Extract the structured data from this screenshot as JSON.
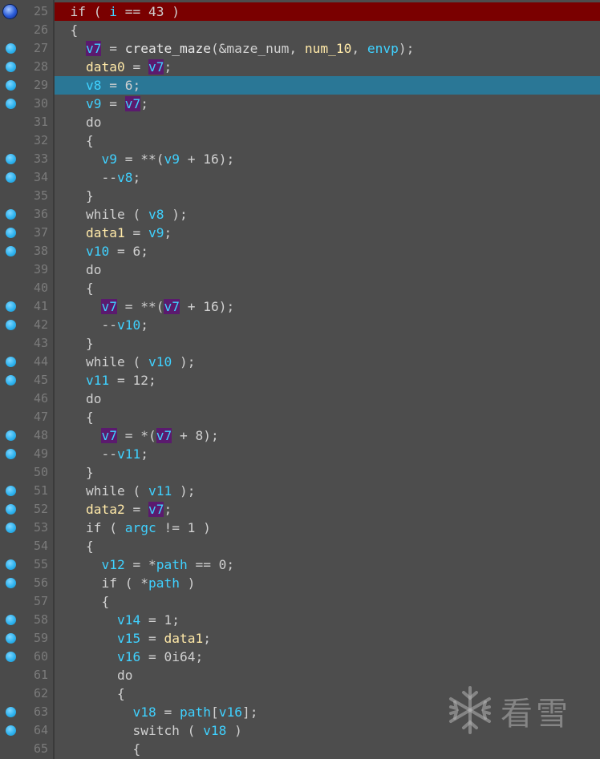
{
  "colors": {
    "background": "#4d4d4d",
    "gutter": "#4a4a4a",
    "current_line_highlight": "#7a0000",
    "selected_line_highlight": "#2a7796",
    "identifier_highlight": "#5b1a6e",
    "local_var": "#3fd1ff",
    "global_var": "#ffe9a8",
    "plain_text": "#d0d0d0",
    "line_number": "#7b7b7b"
  },
  "watermark": {
    "text": "看雪",
    "icon": "snowflake-icon"
  },
  "lines": [
    {
      "num": "25",
      "marker": "breakpoint",
      "highlight": "red",
      "tokens": [
        {
          "t": "  if ( ",
          "c": "kw"
        },
        {
          "t": "i",
          "c": "var"
        },
        {
          "t": " == 43 )",
          "c": "pl"
        }
      ]
    },
    {
      "num": "26",
      "marker": "",
      "highlight": "",
      "tokens": [
        {
          "t": "  {",
          "c": "pl"
        }
      ]
    },
    {
      "num": "27",
      "marker": "dot",
      "highlight": "",
      "tokens": [
        {
          "t": "    ",
          "c": "pl"
        },
        {
          "t": "v7",
          "c": "sel"
        },
        {
          "t": " = ",
          "c": "pl"
        },
        {
          "t": "create_maze",
          "c": "fn"
        },
        {
          "t": "(&maze_num, ",
          "c": "pl"
        },
        {
          "t": "num_10",
          "c": "glob"
        },
        {
          "t": ", ",
          "c": "pl"
        },
        {
          "t": "envp",
          "c": "arg"
        },
        {
          "t": ");",
          "c": "pl"
        }
      ]
    },
    {
      "num": "28",
      "marker": "dot",
      "highlight": "",
      "tokens": [
        {
          "t": "    ",
          "c": "pl"
        },
        {
          "t": "data0",
          "c": "glob"
        },
        {
          "t": " = ",
          "c": "pl"
        },
        {
          "t": "v7",
          "c": "sel"
        },
        {
          "t": ";",
          "c": "pl"
        }
      ]
    },
    {
      "num": "29",
      "marker": "dot",
      "highlight": "blue",
      "tokens": [
        {
          "t": "    ",
          "c": "pl"
        },
        {
          "t": "v8",
          "c": "var"
        },
        {
          "t": " = 6;",
          "c": "pl"
        }
      ]
    },
    {
      "num": "30",
      "marker": "dot",
      "highlight": "",
      "tokens": [
        {
          "t": "    ",
          "c": "pl"
        },
        {
          "t": "v9",
          "c": "var"
        },
        {
          "t": " = ",
          "c": "pl"
        },
        {
          "t": "v7",
          "c": "sel"
        },
        {
          "t": ";",
          "c": "pl"
        }
      ]
    },
    {
      "num": "31",
      "marker": "",
      "highlight": "",
      "tokens": [
        {
          "t": "    do",
          "c": "kw"
        }
      ]
    },
    {
      "num": "32",
      "marker": "",
      "highlight": "",
      "tokens": [
        {
          "t": "    {",
          "c": "pl"
        }
      ]
    },
    {
      "num": "33",
      "marker": "dot",
      "highlight": "",
      "tokens": [
        {
          "t": "      ",
          "c": "pl"
        },
        {
          "t": "v9",
          "c": "var"
        },
        {
          "t": " = **(",
          "c": "pl"
        },
        {
          "t": "v9",
          "c": "var"
        },
        {
          "t": " + 16);",
          "c": "pl"
        }
      ]
    },
    {
      "num": "34",
      "marker": "dot",
      "highlight": "",
      "tokens": [
        {
          "t": "      --",
          "c": "pl"
        },
        {
          "t": "v8",
          "c": "var"
        },
        {
          "t": ";",
          "c": "pl"
        }
      ]
    },
    {
      "num": "35",
      "marker": "",
      "highlight": "",
      "tokens": [
        {
          "t": "    }",
          "c": "pl"
        }
      ]
    },
    {
      "num": "36",
      "marker": "dot",
      "highlight": "",
      "tokens": [
        {
          "t": "    while ( ",
          "c": "kw"
        },
        {
          "t": "v8",
          "c": "var"
        },
        {
          "t": " );",
          "c": "pl"
        }
      ]
    },
    {
      "num": "37",
      "marker": "dot",
      "highlight": "",
      "tokens": [
        {
          "t": "    ",
          "c": "pl"
        },
        {
          "t": "data1",
          "c": "glob"
        },
        {
          "t": " = ",
          "c": "pl"
        },
        {
          "t": "v9",
          "c": "var"
        },
        {
          "t": ";",
          "c": "pl"
        }
      ]
    },
    {
      "num": "38",
      "marker": "dot",
      "highlight": "",
      "tokens": [
        {
          "t": "    ",
          "c": "pl"
        },
        {
          "t": "v10",
          "c": "var"
        },
        {
          "t": " = 6;",
          "c": "pl"
        }
      ]
    },
    {
      "num": "39",
      "marker": "",
      "highlight": "",
      "tokens": [
        {
          "t": "    do",
          "c": "kw"
        }
      ]
    },
    {
      "num": "40",
      "marker": "",
      "highlight": "",
      "tokens": [
        {
          "t": "    {",
          "c": "pl"
        }
      ]
    },
    {
      "num": "41",
      "marker": "dot",
      "highlight": "",
      "tokens": [
        {
          "t": "      ",
          "c": "pl"
        },
        {
          "t": "v7",
          "c": "sel"
        },
        {
          "t": " = **(",
          "c": "pl"
        },
        {
          "t": "v7",
          "c": "sel"
        },
        {
          "t": " + 16);",
          "c": "pl"
        }
      ]
    },
    {
      "num": "42",
      "marker": "dot",
      "highlight": "",
      "tokens": [
        {
          "t": "      --",
          "c": "pl"
        },
        {
          "t": "v10",
          "c": "var"
        },
        {
          "t": ";",
          "c": "pl"
        }
      ]
    },
    {
      "num": "43",
      "marker": "",
      "highlight": "",
      "tokens": [
        {
          "t": "    }",
          "c": "pl"
        }
      ]
    },
    {
      "num": "44",
      "marker": "dot",
      "highlight": "",
      "tokens": [
        {
          "t": "    while ( ",
          "c": "kw"
        },
        {
          "t": "v10",
          "c": "var"
        },
        {
          "t": " );",
          "c": "pl"
        }
      ]
    },
    {
      "num": "45",
      "marker": "dot",
      "highlight": "",
      "tokens": [
        {
          "t": "    ",
          "c": "pl"
        },
        {
          "t": "v11",
          "c": "var"
        },
        {
          "t": " = 12;",
          "c": "pl"
        }
      ]
    },
    {
      "num": "46",
      "marker": "",
      "highlight": "",
      "tokens": [
        {
          "t": "    do",
          "c": "kw"
        }
      ]
    },
    {
      "num": "47",
      "marker": "",
      "highlight": "",
      "tokens": [
        {
          "t": "    {",
          "c": "pl"
        }
      ]
    },
    {
      "num": "48",
      "marker": "dot",
      "highlight": "",
      "tokens": [
        {
          "t": "      ",
          "c": "pl"
        },
        {
          "t": "v7",
          "c": "sel"
        },
        {
          "t": " = *(",
          "c": "pl"
        },
        {
          "t": "v7",
          "c": "sel"
        },
        {
          "t": " + 8);",
          "c": "pl"
        }
      ]
    },
    {
      "num": "49",
      "marker": "dot",
      "highlight": "",
      "tokens": [
        {
          "t": "      --",
          "c": "pl"
        },
        {
          "t": "v11",
          "c": "var"
        },
        {
          "t": ";",
          "c": "pl"
        }
      ]
    },
    {
      "num": "50",
      "marker": "",
      "highlight": "",
      "tokens": [
        {
          "t": "    }",
          "c": "pl"
        }
      ]
    },
    {
      "num": "51",
      "marker": "dot",
      "highlight": "",
      "tokens": [
        {
          "t": "    while ( ",
          "c": "kw"
        },
        {
          "t": "v11",
          "c": "var"
        },
        {
          "t": " );",
          "c": "pl"
        }
      ]
    },
    {
      "num": "52",
      "marker": "dot",
      "highlight": "",
      "tokens": [
        {
          "t": "    ",
          "c": "pl"
        },
        {
          "t": "data2",
          "c": "glob"
        },
        {
          "t": " = ",
          "c": "pl"
        },
        {
          "t": "v7",
          "c": "sel"
        },
        {
          "t": ";",
          "c": "pl"
        }
      ]
    },
    {
      "num": "53",
      "marker": "dot",
      "highlight": "",
      "tokens": [
        {
          "t": "    if ( ",
          "c": "kw"
        },
        {
          "t": "argc",
          "c": "arg"
        },
        {
          "t": " != 1 )",
          "c": "pl"
        }
      ]
    },
    {
      "num": "54",
      "marker": "",
      "highlight": "",
      "tokens": [
        {
          "t": "    {",
          "c": "pl"
        }
      ]
    },
    {
      "num": "55",
      "marker": "dot",
      "highlight": "",
      "tokens": [
        {
          "t": "      ",
          "c": "pl"
        },
        {
          "t": "v12",
          "c": "var"
        },
        {
          "t": " = *",
          "c": "pl"
        },
        {
          "t": "path",
          "c": "var"
        },
        {
          "t": " == 0;",
          "c": "pl"
        }
      ]
    },
    {
      "num": "56",
      "marker": "dot",
      "highlight": "",
      "tokens": [
        {
          "t": "      if ( *",
          "c": "kw"
        },
        {
          "t": "path",
          "c": "var"
        },
        {
          "t": " )",
          "c": "pl"
        }
      ]
    },
    {
      "num": "57",
      "marker": "",
      "highlight": "",
      "tokens": [
        {
          "t": "      {",
          "c": "pl"
        }
      ]
    },
    {
      "num": "58",
      "marker": "dot",
      "highlight": "",
      "tokens": [
        {
          "t": "        ",
          "c": "pl"
        },
        {
          "t": "v14",
          "c": "var"
        },
        {
          "t": " = 1;",
          "c": "pl"
        }
      ]
    },
    {
      "num": "59",
      "marker": "dot",
      "highlight": "",
      "tokens": [
        {
          "t": "        ",
          "c": "pl"
        },
        {
          "t": "v15",
          "c": "var"
        },
        {
          "t": " = ",
          "c": "pl"
        },
        {
          "t": "data1",
          "c": "glob"
        },
        {
          "t": ";",
          "c": "pl"
        }
      ]
    },
    {
      "num": "60",
      "marker": "dot",
      "highlight": "",
      "tokens": [
        {
          "t": "        ",
          "c": "pl"
        },
        {
          "t": "v16",
          "c": "var"
        },
        {
          "t": " = 0i64;",
          "c": "pl"
        }
      ]
    },
    {
      "num": "61",
      "marker": "",
      "highlight": "",
      "tokens": [
        {
          "t": "        do",
          "c": "kw"
        }
      ]
    },
    {
      "num": "62",
      "marker": "",
      "highlight": "",
      "tokens": [
        {
          "t": "        {",
          "c": "pl"
        }
      ]
    },
    {
      "num": "63",
      "marker": "dot",
      "highlight": "",
      "tokens": [
        {
          "t": "          ",
          "c": "pl"
        },
        {
          "t": "v18",
          "c": "var"
        },
        {
          "t": " = ",
          "c": "pl"
        },
        {
          "t": "path",
          "c": "var"
        },
        {
          "t": "[",
          "c": "pl"
        },
        {
          "t": "v16",
          "c": "var"
        },
        {
          "t": "];",
          "c": "pl"
        }
      ]
    },
    {
      "num": "64",
      "marker": "dot",
      "highlight": "",
      "tokens": [
        {
          "t": "          switch ( ",
          "c": "kw"
        },
        {
          "t": "v18",
          "c": "var"
        },
        {
          "t": " )",
          "c": "pl"
        }
      ]
    },
    {
      "num": "65",
      "marker": "",
      "highlight": "",
      "tokens": [
        {
          "t": "          {",
          "c": "pl"
        }
      ]
    }
  ]
}
